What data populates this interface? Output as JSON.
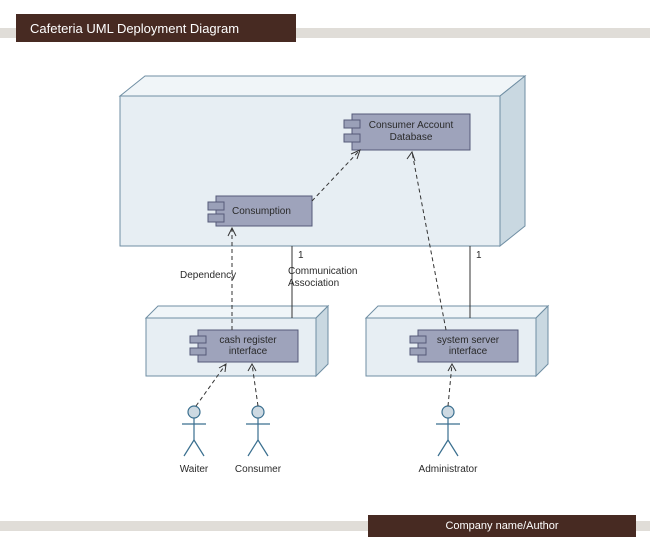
{
  "header": {
    "title": "Cafeteria UML Deployment Diagram"
  },
  "footer": {
    "author": "Company name/Author"
  },
  "components": {
    "consumer_db": "Consumer Account\nDatabase",
    "consumption": "Consumption",
    "cash_register": "cash register\ninterface",
    "system_server": "system server\ninterface"
  },
  "actors": {
    "waiter": "Waiter",
    "consumer": "Consumer",
    "administrator": "Administrator"
  },
  "labels": {
    "dependency": "Dependency",
    "comm_assoc": "Communication\nAssociation",
    "one_a": "1",
    "one_b": "1"
  }
}
